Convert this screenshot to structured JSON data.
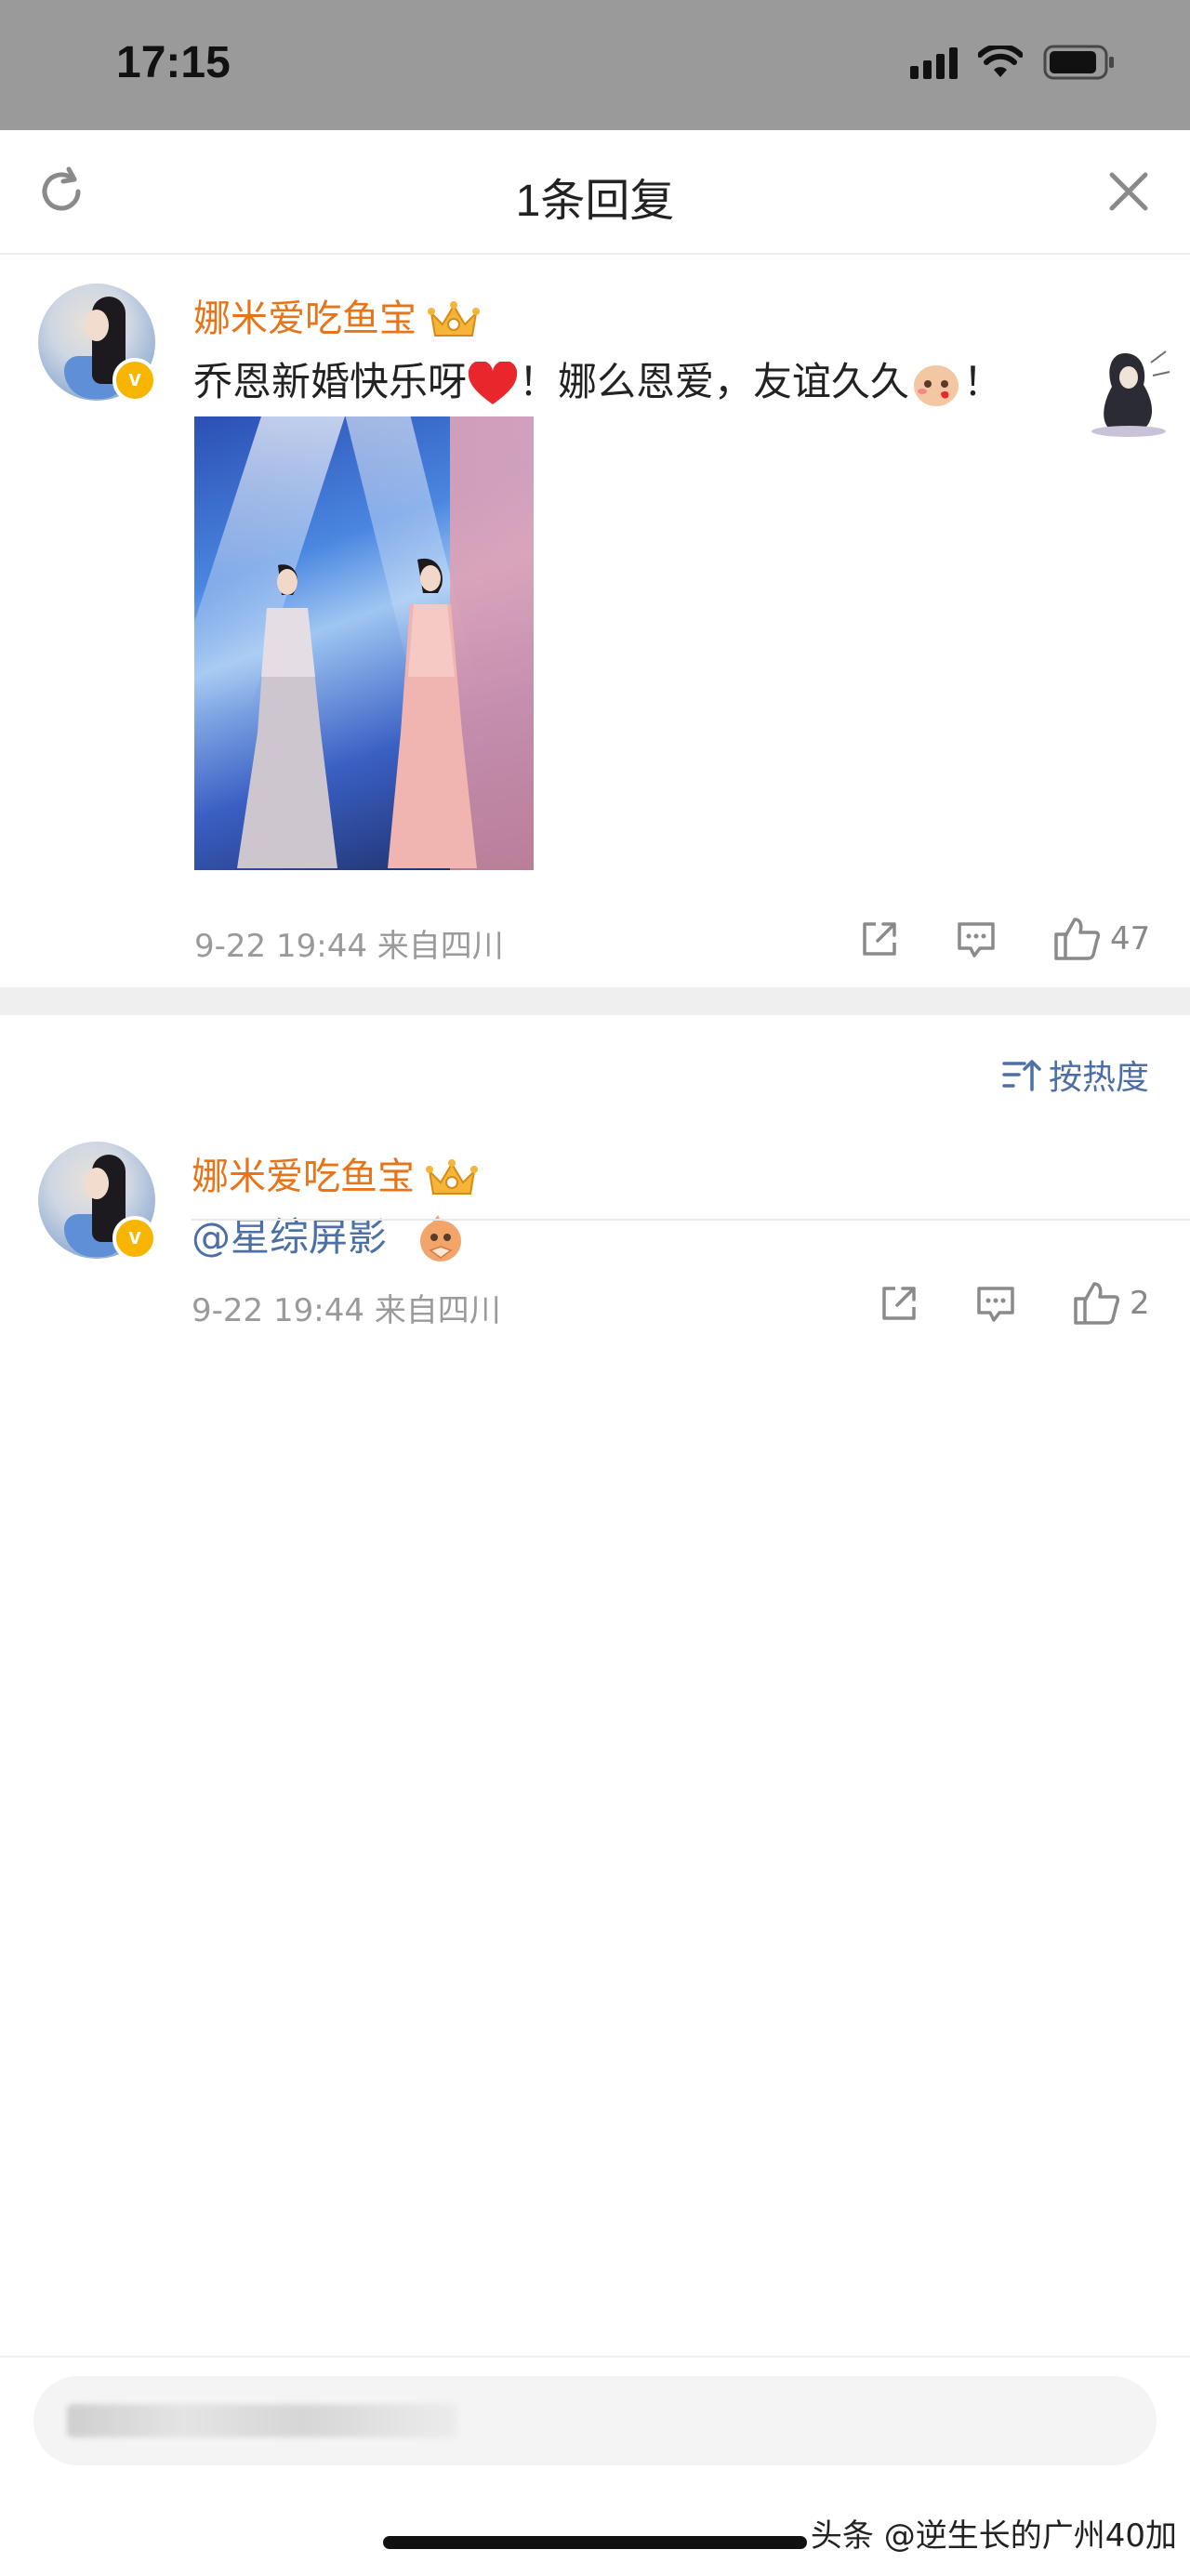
{
  "status_bar": {
    "time": "17:15"
  },
  "header": {
    "title": "1条回复"
  },
  "main_comment": {
    "username": "娜米爱吃鱼宝",
    "text_part1": "乔恩新婚快乐呀",
    "text_part2": "！娜么恩爱，友谊久久",
    "text_part3": "！",
    "meta": "9-22 19:44  来自四川",
    "like_count": "47"
  },
  "sort": {
    "label": "按热度"
  },
  "reply": {
    "username": "娜米爱吃鱼宝",
    "mention": "@星综屏影",
    "meta": "9-22 19:44  来自四川",
    "like_count": "2"
  },
  "watermark": "头条 @逆生长的广州40加",
  "colors": {
    "username": "#e8741a",
    "link": "#4c6fa6",
    "meta": "#9a9a9a"
  }
}
